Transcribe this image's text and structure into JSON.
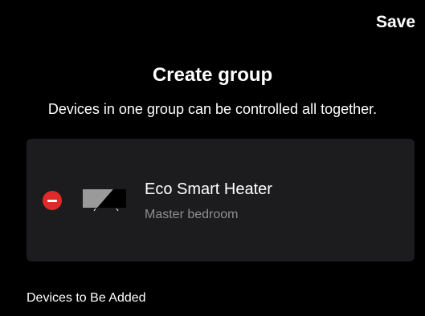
{
  "header": {
    "save_label": "Save",
    "title": "Create group",
    "subtitle": "Devices in one group can be controlled all together."
  },
  "group_devices": [
    {
      "name": "Eco Smart Heater",
      "room": "Master bedroom",
      "icon": "heater-thumbnail-icon"
    }
  ],
  "sections": {
    "to_be_added_label": "Devices to Be Added"
  },
  "colors": {
    "background": "#000000",
    "card": "#1c1c1e",
    "remove": "#e02a27",
    "secondary_text": "#8e8e93"
  }
}
